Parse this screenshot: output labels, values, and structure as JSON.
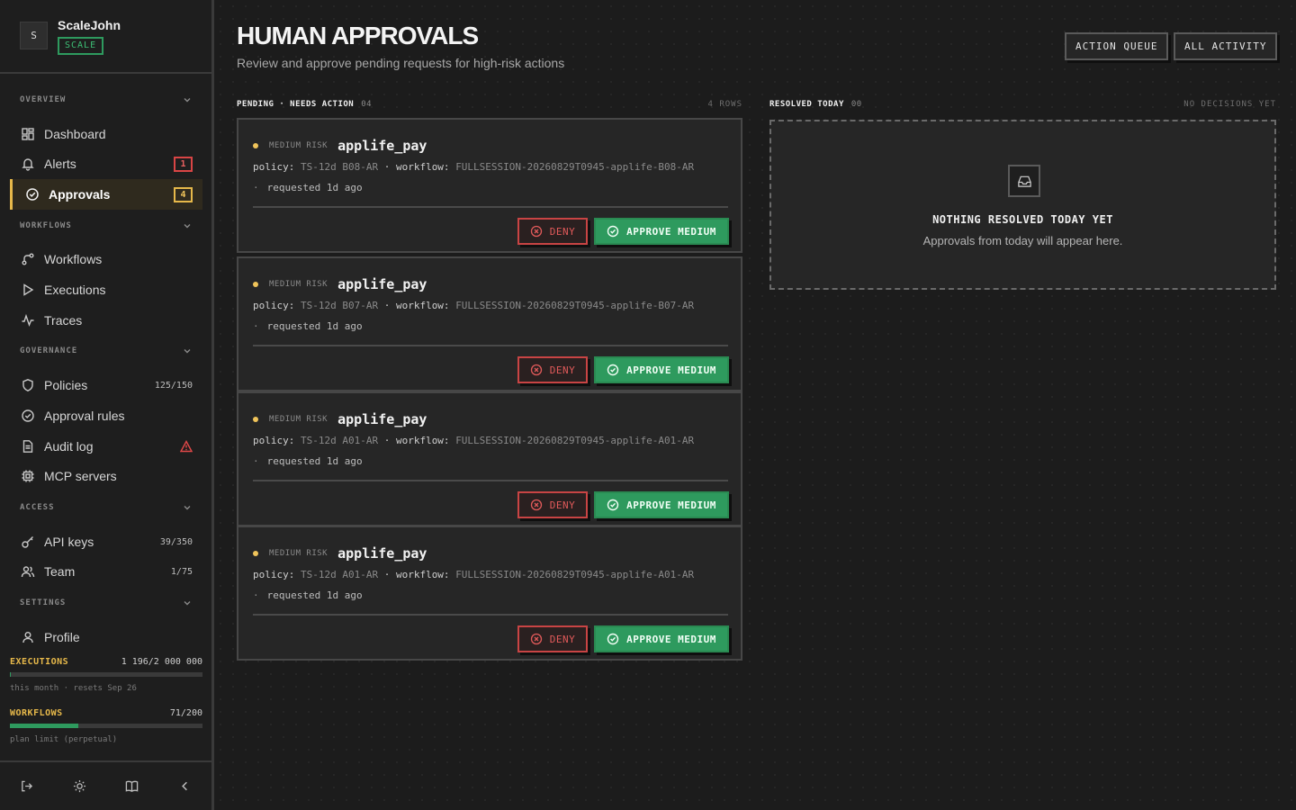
{
  "workspace": {
    "avatar_letter": "S",
    "name": "ScaleJohn",
    "plan": "SCALE"
  },
  "sidebar": {
    "sections": [
      {
        "label": "OVERVIEW",
        "items": [
          {
            "label": "Dashboard",
            "icon": "dashboard-icon"
          },
          {
            "label": "Alerts",
            "icon": "bell-icon",
            "badge": "1"
          },
          {
            "label": "Approvals",
            "icon": "check-circle-icon",
            "badge": "4",
            "active": true
          }
        ]
      },
      {
        "label": "WORKFLOWS",
        "items": [
          {
            "label": "Workflows",
            "icon": "workflow-icon"
          },
          {
            "label": "Executions",
            "icon": "play-icon"
          },
          {
            "label": "Traces",
            "icon": "activity-icon"
          }
        ]
      },
      {
        "label": "GOVERNANCE",
        "items": [
          {
            "label": "Policies",
            "icon": "shield-icon",
            "count": "125/150"
          },
          {
            "label": "Approval rules",
            "icon": "check-circle-icon"
          },
          {
            "label": "Audit log",
            "icon": "document-icon",
            "warning": true
          },
          {
            "label": "MCP servers",
            "icon": "chip-icon"
          }
        ]
      },
      {
        "label": "ACCESS",
        "items": [
          {
            "label": "API keys",
            "icon": "key-icon",
            "count": "39/350"
          },
          {
            "label": "Team",
            "icon": "users-icon",
            "count": "1/75"
          }
        ]
      },
      {
        "label": "SETTINGS",
        "items": [
          {
            "label": "Profile",
            "icon": "user-icon"
          }
        ]
      }
    ],
    "usage": [
      {
        "label": "EXECUTIONS",
        "value": "1 196/2 000 000",
        "fraction": 0.0006,
        "note": "this month · resets Sep 26"
      },
      {
        "label": "WORKFLOWS",
        "value": "71/200",
        "fraction": 0.355,
        "note": "plan limit (perpetual)"
      }
    ]
  },
  "header": {
    "title": "HUMAN APPROVALS",
    "subtitle": "Review and approve pending requests for high-risk actions",
    "buttons": [
      "ACTION QUEUE",
      "ALL ACTIVITY"
    ]
  },
  "pending": {
    "title": "PENDING · NEEDS ACTION",
    "count": "04",
    "meta": "4 ROWS",
    "items": [
      {
        "risk": "MEDIUM RISK",
        "tool": "applife_pay",
        "policy_label": "policy:",
        "policy": "TS-12d B08-AR",
        "workflow_label": "workflow:",
        "workflow": "FULLSESSION-20260829T0945-applife-B08-AR",
        "requested": "requested 1d ago",
        "deny": "DENY",
        "approve": "APPROVE MEDIUM"
      },
      {
        "risk": "MEDIUM RISK",
        "tool": "applife_pay",
        "policy_label": "policy:",
        "policy": "TS-12d B07-AR",
        "workflow_label": "workflow:",
        "workflow": "FULLSESSION-20260829T0945-applife-B07-AR",
        "requested": "requested 1d ago",
        "deny": "DENY",
        "approve": "APPROVE MEDIUM"
      },
      {
        "risk": "MEDIUM RISK",
        "tool": "applife_pay",
        "policy_label": "policy:",
        "policy": "TS-12d A01-AR",
        "workflow_label": "workflow:",
        "workflow": "FULLSESSION-20260829T0945-applife-A01-AR",
        "requested": "requested 1d ago",
        "deny": "DENY",
        "approve": "APPROVE MEDIUM"
      },
      {
        "risk": "MEDIUM RISK",
        "tool": "applife_pay",
        "policy_label": "policy:",
        "policy": "TS-12d A01-AR",
        "workflow_label": "workflow:",
        "workflow": "FULLSESSION-20260829T0945-applife-A01-AR",
        "requested": "requested 1d ago",
        "deny": "DENY",
        "approve": "APPROVE MEDIUM"
      }
    ]
  },
  "resolved": {
    "title": "RESOLVED TODAY",
    "count": "00",
    "meta": "NO DECISIONS YET",
    "empty_title": "NOTHING RESOLVED TODAY YET",
    "empty_text": "Approvals from today will appear here."
  },
  "colors": {
    "accent": "#e6b84a",
    "approve": "#2e9a5e",
    "deny": "#c84444",
    "background": "#1c1c1c"
  }
}
